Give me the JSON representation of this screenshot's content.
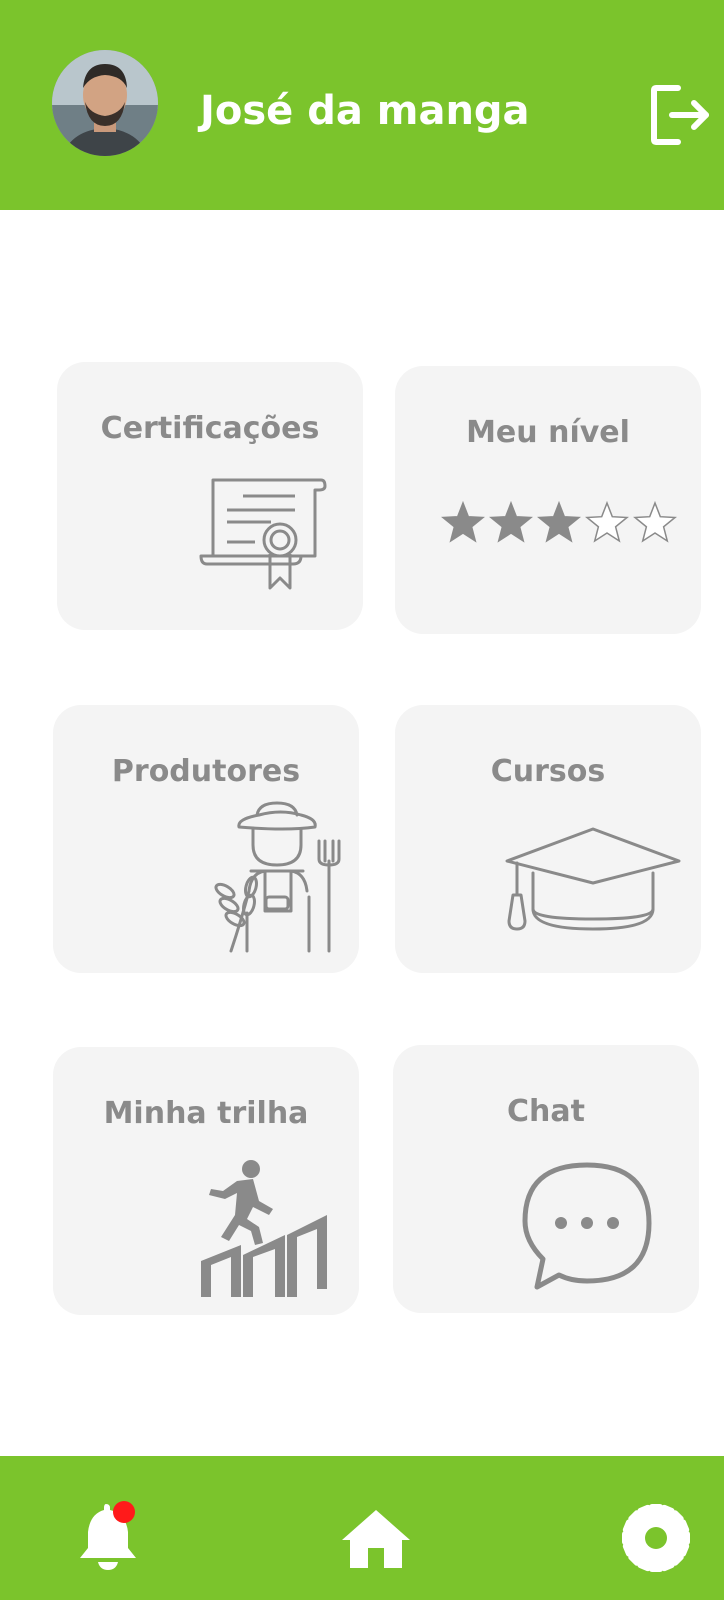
{
  "header": {
    "user_name": "José da manga",
    "avatar": "user-avatar-photo",
    "logout_icon": "logout-icon"
  },
  "menu": [
    {
      "label": "Certificações",
      "icon": "certificate-icon"
    },
    {
      "label": "Meu nível",
      "icon": "stars-rating",
      "rating": 3,
      "rating_max": 5
    },
    {
      "label": "Produtores",
      "icon": "farmer-icon"
    },
    {
      "label": "Cursos",
      "icon": "graduation-cap-icon"
    },
    {
      "label": "Minha trilha",
      "icon": "climbing-steps-icon"
    },
    {
      "label": "Chat",
      "icon": "chat-bubble-icon"
    }
  ],
  "footer": {
    "items": [
      {
        "icon": "bell-icon",
        "has_notification": true
      },
      {
        "icon": "home-icon"
      },
      {
        "icon": "gear-icon"
      }
    ]
  },
  "colors": {
    "brand_green": "#7bc42c",
    "card_bg": "#f4f4f4",
    "text_gray": "#8a8a8a",
    "notification_red": "#ff1a1a"
  }
}
